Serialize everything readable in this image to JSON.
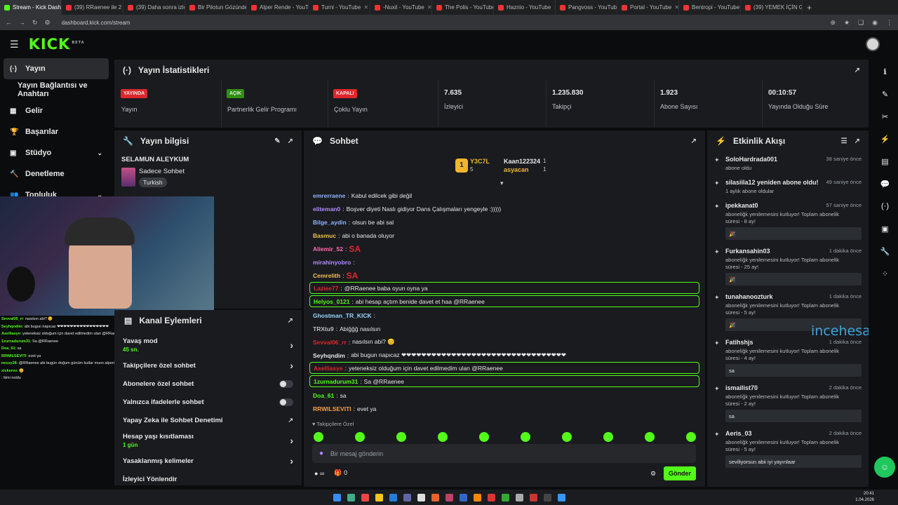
{
  "browser": {
    "tabs": [
      {
        "title": "Stream - Kick Dashb",
        "active": true
      },
      {
        "title": "(39) RRaenee ile 2 s",
        "active": false
      },
      {
        "title": "(39) Daha sonra izle",
        "active": false
      },
      {
        "title": "Bir Pilotun Gözünde",
        "active": false
      },
      {
        "title": "Alper Rende - YouT",
        "active": false
      },
      {
        "title": "Turni - YouTube",
        "active": false
      },
      {
        "title": "-Nuxil - YouTube",
        "active": false
      },
      {
        "title": "The Polis - YouTube",
        "active": false
      },
      {
        "title": "Haznio - YouTube",
        "active": false
      },
      {
        "title": "Pangvoss - YouTube",
        "active": false
      },
      {
        "title": "Portal - YouTube",
        "active": false
      },
      {
        "title": "Bentropi - YouTube",
        "active": false
      },
      {
        "title": "(39) YEMEK İÇİN Gİ",
        "active": false
      }
    ],
    "new_tab": "+",
    "url": "dashboard.kick.com/stream"
  },
  "logo": {
    "text": "KICK",
    "sup": "BETA"
  },
  "sidebar": {
    "items": [
      {
        "label": "Yayın",
        "icon": "(·)",
        "active": true
      },
      {
        "label": "Yayın Bağlantısı ve Anahtarı",
        "icon": "",
        "active": false
      },
      {
        "label": "Gelir",
        "icon": "▦",
        "active": false
      },
      {
        "label": "Başarılar",
        "icon": "🏆",
        "active": false
      },
      {
        "label": "Stüdyo",
        "icon": "▣",
        "active": false,
        "chevron": "⌄"
      },
      {
        "label": "Denetleme",
        "icon": "🔨",
        "active": false
      },
      {
        "label": "Topluluk",
        "icon": "👥",
        "active": false,
        "chevron": "⌄"
      }
    ]
  },
  "stats": {
    "title": "Yayın İstatistikleri",
    "items": [
      {
        "badge": "YAYINDA",
        "badge_color": "#e0262d",
        "label": "Yayın"
      },
      {
        "badge": "AÇIK",
        "badge_color": "#2f8f12",
        "label": "Partnerlik Gelir Programı"
      },
      {
        "badge": "KAPALI",
        "badge_color": "#e0262d",
        "label": "Çoklu Yayın"
      },
      {
        "value": "7.635",
        "label": "İzleyici"
      },
      {
        "value": "1.235.830",
        "label": "Takipçi"
      },
      {
        "value": "1.923",
        "label": "Abone Sayısı"
      },
      {
        "value": "00:10:57",
        "label": "Yayında Olduğu Süre"
      }
    ]
  },
  "stream_info": {
    "title": "Yayın bilgisi",
    "stream_title": "SELAMUN ALEYKUM",
    "category": "Sadece Sohbet",
    "tag": "Turkish"
  },
  "channel_actions": {
    "title": "Kanal Eylemleri",
    "items": [
      {
        "label": "Yavaş mod",
        "sub": "45 sn.",
        "ctrl": "›"
      },
      {
        "label": "Takipçilere özel sohbet",
        "sub": "",
        "ctrl": "›"
      },
      {
        "label": "Abonelere özel sohbet",
        "sub": "",
        "ctrl": "toggle"
      },
      {
        "label": "Yalnızca ifadelerle sohbet",
        "sub": "",
        "ctrl": "toggle"
      },
      {
        "label": "Yapay Zeka ile Sohbet Denetimi",
        "sub": "",
        "ctrl": "↗"
      },
      {
        "label": "Hesap yaşı kısıtlaması",
        "sub": "1 gün",
        "ctrl": "›"
      },
      {
        "label": "Yasaklanmış kelimeler",
        "sub": "",
        "ctrl": "›"
      },
      {
        "label": "İzleyici Yönlendir",
        "sub": "",
        "ctrl": ""
      }
    ]
  },
  "chat": {
    "title": "Sohbet",
    "leaderboard": [
      {
        "rank": "1",
        "name": "Y3C7L",
        "count": "5"
      },
      {
        "rank": "",
        "name": "Kaan122324",
        "count": "1"
      },
      {
        "rank": "",
        "name": "asyacan",
        "count": "1"
      }
    ],
    "messages": [
      {
        "user": "emrerraene",
        "color": "#8fb5ff",
        "text": "Kabul edilcek gibi değil",
        "hl": false
      },
      {
        "user": "eliteman0",
        "color": "#b28cff",
        "text": "Boşver diyeti Naslı gidiyor Dans Çalışmaları yengeyle :)))))",
        "hl": false
      },
      {
        "user": "Bilge_aydin",
        "color": "#8fb5ff",
        "text": "olsun be abi sal",
        "hl": false
      },
      {
        "user": "Basmuc",
        "color": "#f3c04d",
        "text": "abi o banada oluyor",
        "hl": false
      },
      {
        "user": "Aliemir_52",
        "color": "#ff6fb5",
        "text": "SA",
        "hl": false
      },
      {
        "user": "mirahinyobro",
        "color": "#b28cff",
        "text": "",
        "hl": false
      },
      {
        "user": "Cemrelith",
        "color": "#f3c04d",
        "text": "SA",
        "hl": false
      },
      {
        "user": "Laziee77",
        "color": "#e0262d",
        "text": "@RRaenee baba oyun oyna ya",
        "hl": true
      },
      {
        "user": "Helyos_0121",
        "color": "#53fc18",
        "text": "abi hesap açtım benide davet et haa @RRaenee",
        "hl": true
      },
      {
        "user": "Ghostman_TR_KICK",
        "color": "#9ad6ff",
        "text": "",
        "hl": false
      },
      {
        "user": "TRXtu9",
        "color": "#bbbbbb",
        "text": "Abiğğğ nasılsın",
        "hl": false
      },
      {
        "user": "Sevval06_rr",
        "color": "#e0262d",
        "text": "nasılsın abi? 😊",
        "hl": false
      },
      {
        "user": "Seyhqndim",
        "color": "#e8e8e8",
        "text": "abi bugun napıcaz ❤❤❤❤❤❤❤❤❤❤❤❤❤❤❤❤❤❤❤❤❤❤❤❤❤❤❤❤❤❤❤❤❤",
        "hl": false
      },
      {
        "user": "Aselliasye",
        "color": "#e0262d",
        "text": "yeteneksiz olduğum için davet edilmedim ulan @RRaenee",
        "hl": true
      },
      {
        "user": "1zurnadurum31",
        "color": "#53fc18",
        "text": "Sa @RRaenee",
        "hl": true
      },
      {
        "user": "Doa_61",
        "color": "#53fc18",
        "text": "sa",
        "hl": false
      },
      {
        "user": "RRWILSEVITI",
        "color": "#f3a04d",
        "text": "evet ya",
        "hl": false
      }
    ],
    "mode_label": "Takipçilere Özel",
    "placeholder": "Bir mesaj gönderin",
    "points": "∞",
    "points_icon": "●",
    "gift_count": "0",
    "send": "Gönder"
  },
  "feed": {
    "title": "Etkinlik Akışı",
    "items": [
      {
        "name": "SoloHardrada001",
        "time": "38 saniye önce",
        "desc": "abone oldu",
        "msg": ""
      },
      {
        "name": "silasiila12 yeniden abone oldu!",
        "time": "49 saniye önce",
        "desc": "1 aylık abone oldular",
        "msg": ""
      },
      {
        "name": "ipekkanat0",
        "time": "57 saniye önce",
        "desc": "aboneliğk yenilemesini kutluyor! Toplam abonelik süresi - 8 ay!",
        "msg": "🎉"
      },
      {
        "name": "Furkansahin03",
        "time": "1 dakika önce",
        "desc": "aboneliğk yenilemesini kutluyor! Toplam abonelik süresi - 25 ay!",
        "msg": "🎉"
      },
      {
        "name": "tunahanoozturk",
        "time": "1 dakika önce",
        "desc": "aboneliğk yenilemesini kutluyor! Toplam abonelik süresi - 5 ay!",
        "msg": "🎉"
      },
      {
        "name": "Fatihshjs",
        "time": "1 dakika önce",
        "desc": "aboneliğk yenilemesini kutluyor! Toplam abonelik süresi - 4 ay!",
        "msg": "sa"
      },
      {
        "name": "ismailist70",
        "time": "2 dakika önce",
        "desc": "aboneliğk yenilemesini kutluyor! Toplam abonelik süresi - 2 ay!",
        "msg": "sa"
      },
      {
        "name": "Aeris_03",
        "time": "2 dakika önce",
        "desc": "aboneliğk yenilemesini kutluyor! Toplam abonelik süresi - 5 ay!",
        "msg": "seviliyorsun abii iyi yayınlaar"
      }
    ]
  },
  "watermark": "incehesap.com",
  "webcam_chat": [
    {
      "user": "Sevval06_rr",
      "text": "nasılsın abi? 😊"
    },
    {
      "user": "Seyhqndim",
      "text": "abi bugun napıcaz ❤❤❤❤❤❤❤❤❤❤❤❤❤❤❤❤"
    },
    {
      "user": "Aselliasye",
      "text": "yeteneksiz olduğum için davet edilmedim ulan @RRaenee"
    },
    {
      "user": "1zurnadurum31",
      "text": "Sa @RRaenee"
    },
    {
      "user": "Doa_61",
      "text": "sa"
    },
    {
      "user": "RRWILSEVITI",
      "text": "evet ya"
    },
    {
      "user": "nessy28",
      "text": "@RRaenee abi bugün doğum günüm kutlar mısın alperi ph"
    },
    {
      "user": "xickerov",
      "text": "😊"
    },
    {
      "user": "",
      "text": "ltimi noldu"
    }
  ],
  "clock": {
    "time": "20:41",
    "date": "1.04.2026"
  }
}
